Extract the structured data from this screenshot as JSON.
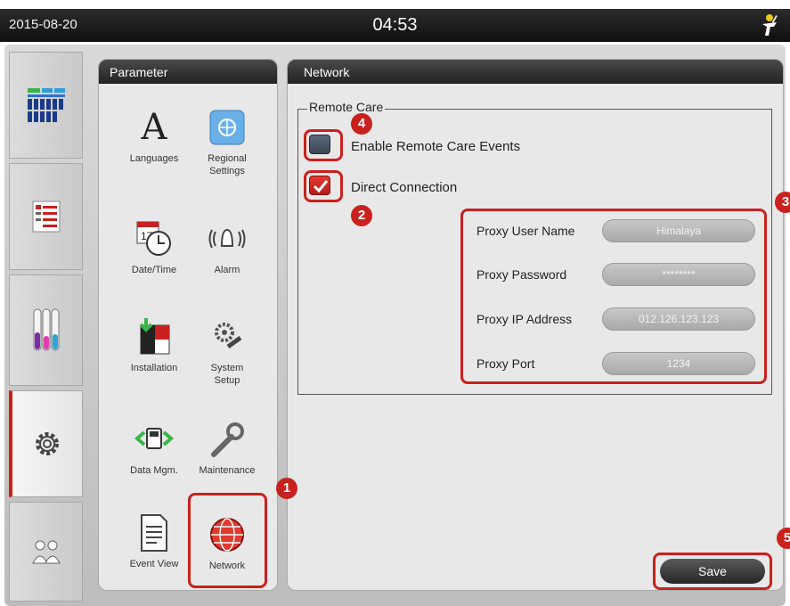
{
  "topbar": {
    "date": "2015-08-20",
    "time": "04:53",
    "user_icon": "user-tools-icon"
  },
  "tabs": [
    {
      "name": "overview",
      "icon": "programs-grid-icon"
    },
    {
      "name": "programs",
      "icon": "program-list-icon"
    },
    {
      "name": "reagents",
      "icon": "reagent-tubes-icon"
    },
    {
      "name": "settings",
      "icon": "gear-icon",
      "active": true
    },
    {
      "name": "user",
      "icon": "user-icon"
    }
  ],
  "parameter": {
    "title": "Parameter",
    "items": {
      "languages": "Languages",
      "regional": "Regional\nSettings",
      "datetime": "Date/Time",
      "alarm": "Alarm",
      "installation": "Installation",
      "system": "System\nSetup",
      "datamgm": "Data Mgm.",
      "maintenance": "Maintenance",
      "eventview": "Event View",
      "network": "Network"
    }
  },
  "network": {
    "title": "Network",
    "group_title": "Remote Care",
    "enable_remote_label": "Enable Remote Care Events",
    "enable_remote_checked": false,
    "direct_connection_label": "Direct Connection",
    "direct_connection_checked": true,
    "fields": {
      "user_label": "Proxy User Name",
      "user_value": "Himalaya",
      "password_label": "Proxy Password",
      "password_value": "********",
      "ip_label": "Proxy IP Address",
      "ip_value": "012.126.123.123",
      "port_label": "Proxy Port",
      "port_value": "1234"
    },
    "save_label": "Save"
  },
  "badges": {
    "b1": "1",
    "b2": "2",
    "b3": "3",
    "b4": "4",
    "b5": "5"
  },
  "colors": {
    "accent_red": "#c9211e",
    "header_dark": "#222222",
    "panel_bg": "#e8e8e8"
  }
}
